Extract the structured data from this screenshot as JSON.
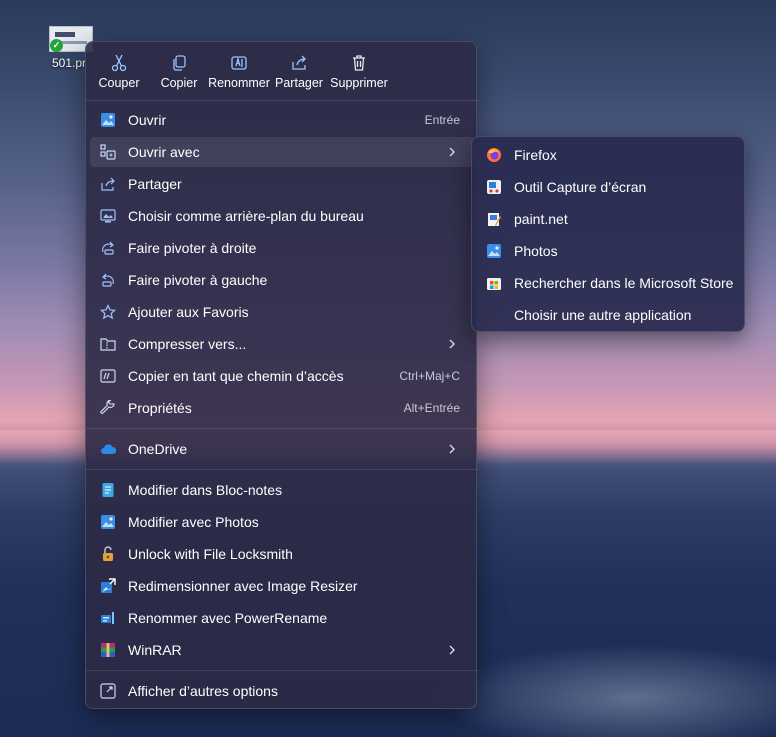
{
  "desktop": {
    "file_label": "501.pr"
  },
  "quick_actions": [
    {
      "label": "Couper",
      "icon": "scissors-icon"
    },
    {
      "label": "Copier",
      "icon": "copy-icon"
    },
    {
      "label": "Renommer",
      "icon": "rename-icon"
    },
    {
      "label": "Partager",
      "icon": "share-icon"
    },
    {
      "label": "Supprimer",
      "icon": "trash-icon"
    }
  ],
  "menu": {
    "items": [
      {
        "label": "Ouvrir",
        "shortcut": "Entrée",
        "icon": "photos-icon"
      },
      {
        "label": "Ouvrir avec",
        "icon": "open-with-icon",
        "submenu": true
      },
      {
        "label": "Partager",
        "icon": "share-icon"
      },
      {
        "label": "Choisir comme arrière-plan du bureau",
        "icon": "wallpaper-icon"
      },
      {
        "label": "Faire pivoter à droite",
        "icon": "rotate-right-icon"
      },
      {
        "label": "Faire pivoter à gauche",
        "icon": "rotate-left-icon"
      },
      {
        "label": "Ajouter aux Favoris",
        "icon": "star-icon"
      },
      {
        "label": "Compresser vers...",
        "icon": "compress-folder-icon",
        "submenu": true
      },
      {
        "label": "Copier en tant que chemin d’accès",
        "shortcut": "Ctrl+Maj+C",
        "icon": "copy-path-icon"
      },
      {
        "label": "Propriétés",
        "shortcut": "Alt+Entrée",
        "icon": "wrench-icon"
      },
      {
        "label": "OneDrive",
        "icon": "onedrive-icon",
        "submenu": true
      },
      {
        "label": "Modifier dans Bloc-notes",
        "icon": "notepad-icon"
      },
      {
        "label": "Modifier avec Photos",
        "icon": "photos-edit-icon"
      },
      {
        "label": "Unlock with File Locksmith",
        "icon": "lock-icon"
      },
      {
        "label": "Redimensionner avec Image Resizer",
        "icon": "image-resizer-icon"
      },
      {
        "label": "Renommer avec PowerRename",
        "icon": "power-rename-icon"
      },
      {
        "label": "WinRAR",
        "icon": "winrar-icon",
        "submenu": true
      },
      {
        "label": "Afficher d’autres options",
        "icon": "more-options-icon"
      }
    ]
  },
  "submenu": {
    "items": [
      {
        "label": "Firefox",
        "icon": "firefox-icon"
      },
      {
        "label": "Outil Capture d’écran",
        "icon": "snipping-tool-icon"
      },
      {
        "label": "paint.net",
        "icon": "paintnet-icon"
      },
      {
        "label": "Photos",
        "icon": "photos-icon"
      },
      {
        "label": "Rechercher dans le Microsoft Store",
        "icon": "microsoft-store-icon"
      },
      {
        "label": "Choisir une autre application",
        "icon": ""
      }
    ]
  }
}
